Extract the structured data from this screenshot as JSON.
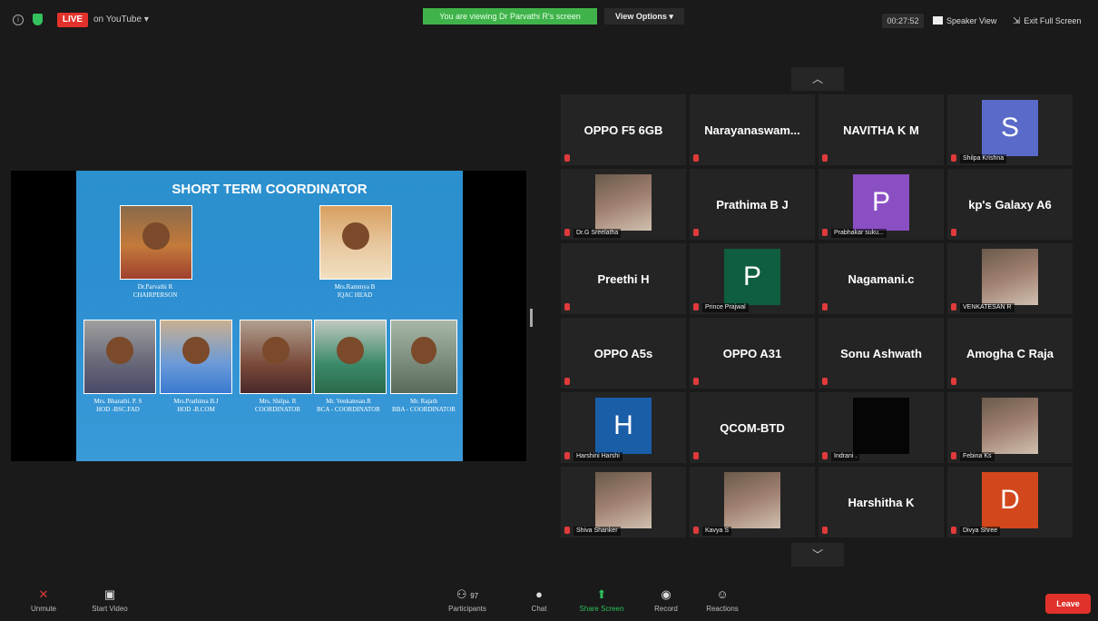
{
  "topbar": {
    "live_label": "LIVE",
    "on_youtube_label": "on YouTube",
    "viewing_banner": "You are viewing Dr Parvathi R's screen",
    "view_options_label": "View Options",
    "timer": "00:27:52",
    "speaker_view_label": "Speaker View",
    "exit_fullscreen_label": "Exit Full Screen"
  },
  "slide": {
    "title": "SHORT TERM COORDINATOR",
    "top_people": [
      {
        "name": "Dr.Parvathi R",
        "role": "CHAIRPERSON"
      },
      {
        "name": "Mrs.Rammya B",
        "role": "IQAC HEAD"
      }
    ],
    "bottom_people": [
      {
        "name": "Mrs. Bharathi. P. S",
        "role": "HOD -BSC.FAD"
      },
      {
        "name": "Mrs.Prathima B.J",
        "role": "HOD -B.COM"
      },
      {
        "name": "Mrs. Shilpa. R",
        "role": "COORDINATOR"
      },
      {
        "name": "Mr. Venkatesan.R",
        "role": "BCA - COORDINATOR"
      },
      {
        "name": "Mr. Rajath",
        "role": "BBA - COORDINATOR"
      }
    ]
  },
  "gallery": {
    "tiles": [
      {
        "type": "name",
        "text": "OPPO F5 6GB",
        "label": ""
      },
      {
        "type": "name",
        "text": "Narayanaswam...",
        "label": ""
      },
      {
        "type": "name",
        "text": "NAVITHA K M",
        "label": ""
      },
      {
        "type": "avatar",
        "letter": "S",
        "color": "#5a6ac8",
        "label": "Shilpa Krishna"
      },
      {
        "type": "photo",
        "label": "Dr.G Sreelatha"
      },
      {
        "type": "name",
        "text": "Prathima B J",
        "label": ""
      },
      {
        "type": "avatar",
        "letter": "P",
        "color": "#8b4fc4",
        "label": "Prabhakar suku..."
      },
      {
        "type": "name",
        "text": "kp's Galaxy A6",
        "label": ""
      },
      {
        "type": "name",
        "text": "Preethi H",
        "label": ""
      },
      {
        "type": "avatar",
        "letter": "P",
        "color": "#0e5e3f",
        "label": "Prince Prajwal"
      },
      {
        "type": "name",
        "text": "Nagamani.c",
        "label": ""
      },
      {
        "type": "photo",
        "label": "VENKATESAN R"
      },
      {
        "type": "name",
        "text": "OPPO A5s",
        "label": ""
      },
      {
        "type": "name",
        "text": "OPPO A31",
        "label": ""
      },
      {
        "type": "name",
        "text": "Sonu Ashwath",
        "label": ""
      },
      {
        "type": "name",
        "text": "Amogha C Raja",
        "label": ""
      },
      {
        "type": "avatar",
        "letter": "H",
        "color": "#1a5ea8",
        "label": "Harshini Harshi"
      },
      {
        "type": "name",
        "text": "QCOM-BTD",
        "label": ""
      },
      {
        "type": "dark",
        "label": "Indrani ."
      },
      {
        "type": "photo",
        "label": "Febina Ks"
      },
      {
        "type": "photo",
        "label": "Shiva Shanker"
      },
      {
        "type": "photo",
        "label": "Kavya S"
      },
      {
        "type": "name",
        "text": "Harshitha K",
        "label": ""
      },
      {
        "type": "avatar",
        "letter": "D",
        "color": "#d2481c",
        "label": "Divya Shree"
      }
    ]
  },
  "bottombar": {
    "unmute_label": "Unmute",
    "start_video_label": "Start Video",
    "participants_label": "Participants",
    "participants_count": "97",
    "chat_label": "Chat",
    "share_screen_label": "Share Screen",
    "record_label": "Record",
    "reactions_label": "Reactions",
    "leave_label": "Leave"
  },
  "colors": {
    "live": "#e2322b",
    "banner_green": "#3fb34a",
    "leave": "#e0322b",
    "share_green": "#2fbf5a",
    "mic_off_red": "#e03a3a"
  }
}
